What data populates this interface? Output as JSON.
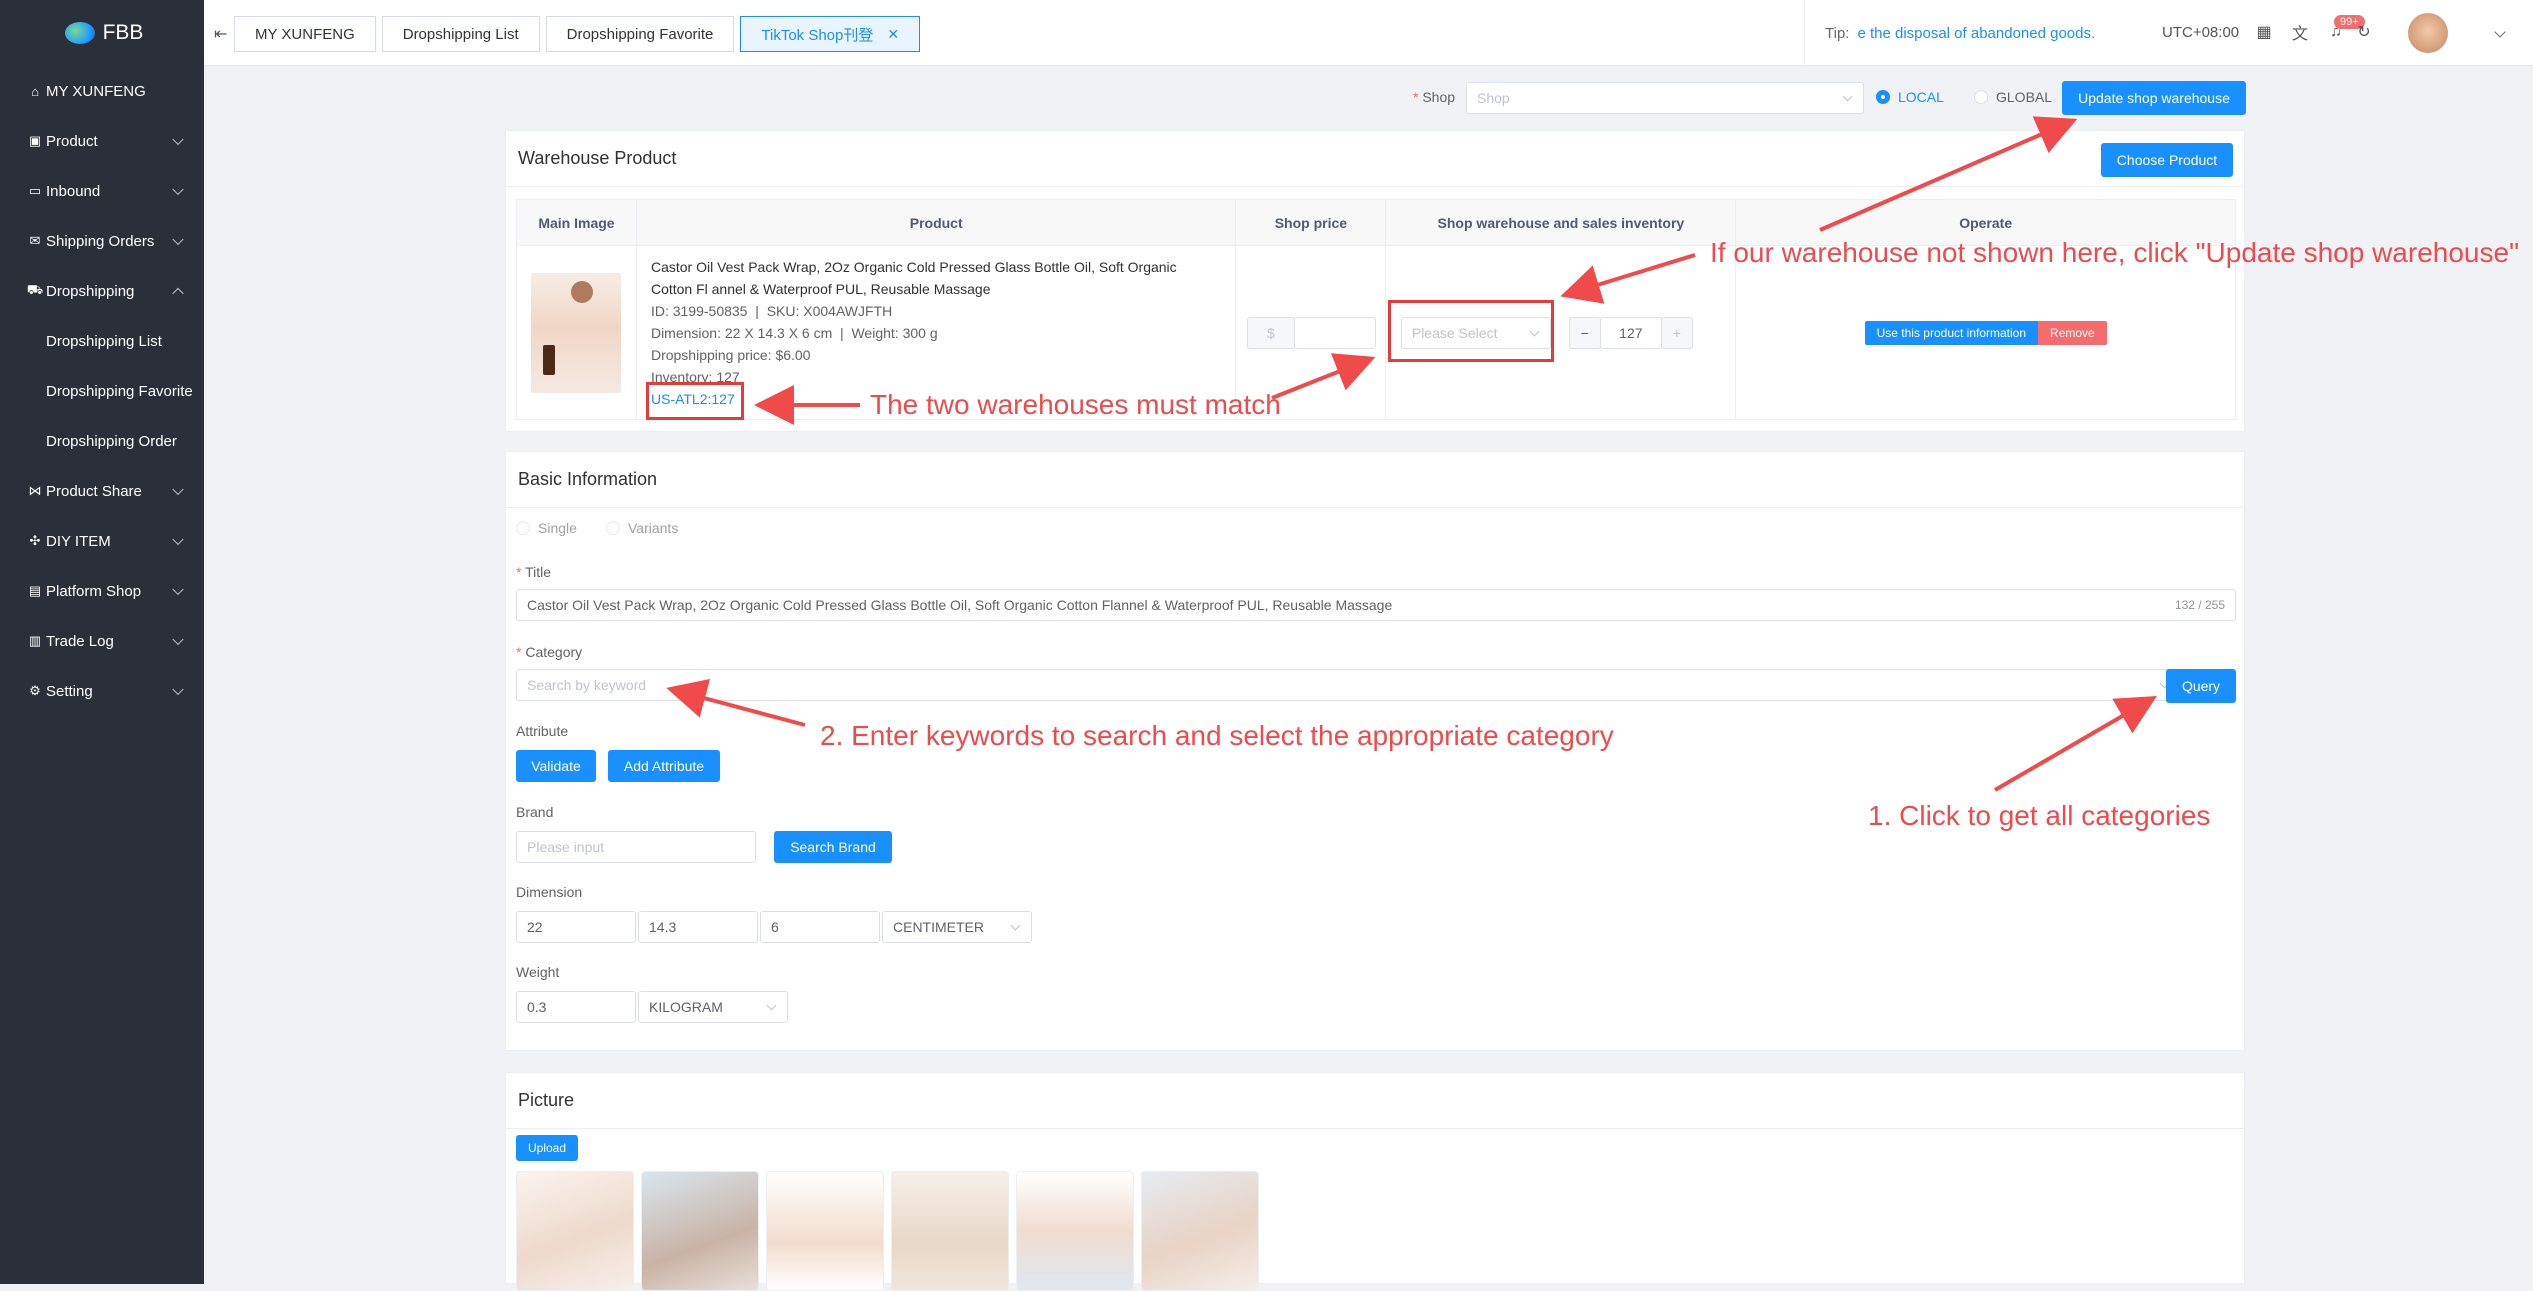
{
  "app": {
    "name": "FBB"
  },
  "sidebar": {
    "items": [
      {
        "label": "MY XUNFENG",
        "icon": "home-icon"
      },
      {
        "label": "Product",
        "icon": "gift-icon"
      },
      {
        "label": "Inbound",
        "icon": "folder-open-icon"
      },
      {
        "label": "Shipping Orders",
        "icon": "mail-icon"
      },
      {
        "label": "Dropshipping",
        "icon": "cart-icon"
      },
      {
        "label": "Product Share",
        "icon": "share-icon"
      },
      {
        "label": "DIY ITEM",
        "icon": "puzzle-icon"
      },
      {
        "label": "Platform Shop",
        "icon": "shop-icon"
      },
      {
        "label": "Trade Log",
        "icon": "document-icon"
      },
      {
        "label": "Setting",
        "icon": "gear-icon"
      }
    ],
    "dropshipping_children": [
      "Dropshipping List",
      "Dropshipping Favorite",
      "Dropshipping Order"
    ]
  },
  "tabs": [
    {
      "label": "MY XUNFENG"
    },
    {
      "label": "Dropshipping List"
    },
    {
      "label": "Dropshipping Favorite"
    },
    {
      "label": "TikTok Shop刊登",
      "active": true
    }
  ],
  "header": {
    "tip_label": "Tip:",
    "tip_text": "e the disposal of abandoned goods.",
    "timezone": "UTC+08:00",
    "notification_badge": "99+"
  },
  "shop_bar": {
    "label": "Shop",
    "placeholder": "Shop",
    "radio_local": "LOCAL",
    "radio_global": "GLOBAL",
    "selected": "LOCAL",
    "update_button": "Update shop warehouse"
  },
  "warehouse_product": {
    "title": "Warehouse Product",
    "choose_button": "Choose Product",
    "columns": [
      "Main Image",
      "Product",
      "Shop price",
      "Shop warehouse and sales inventory",
      "Operate"
    ],
    "row": {
      "title": "Castor Oil Vest Pack Wrap, 2Oz Organic Cold Pressed Glass Bottle Oil, Soft Organic Cotton Fl annel & Waterproof PUL, Reusable Massage",
      "id": "ID: 3199-50835",
      "sku": "SKU: X004AWJFTH",
      "dimension": "Dimension: 22 X 14.3 X 6 cm",
      "weight": "Weight: 300 g",
      "dropshipping_price": "Dropshipping price: $6.00",
      "inventory": "Inventory: 127",
      "warehouse": "US-ATL2:127",
      "currency": "$",
      "select_placeholder": "Please Select",
      "quantity": "127",
      "use_info_button": "Use this product information",
      "remove_button": "Remove"
    }
  },
  "basic_info": {
    "title": "Basic Information",
    "radio_single": "Single",
    "radio_variants": "Variants",
    "title_label": "Title",
    "title_value": "Castor Oil Vest Pack Wrap, 2Oz Organic Cold Pressed Glass Bottle Oil, Soft Organic Cotton Flannel & Waterproof PUL, Reusable Massage",
    "title_count": "132 / 255",
    "category_label": "Category",
    "category_placeholder": "Search by keyword",
    "query_button": "Query",
    "attribute_label": "Attribute",
    "validate_button": "Validate",
    "add_attribute_button": "Add Attribute",
    "brand_label": "Brand",
    "brand_placeholder": "Please input",
    "search_brand_button": "Search Brand",
    "dimension_label": "Dimension",
    "dim_length": "22",
    "dim_width": "14.3",
    "dim_height": "6",
    "dim_unit": "CENTIMETER",
    "weight_label": "Weight",
    "weight_value": "0.3",
    "weight_unit": "KILOGRAM"
  },
  "picture": {
    "title": "Picture",
    "upload_button": "Upload",
    "image_count": 6
  },
  "annotations": {
    "update_warehouse_note": "If our warehouse not shown here,  click \"Update shop warehouse\"",
    "match_note": "The two warehouses must match",
    "category_note": "2. Enter keywords to search and select the appropriate category",
    "query_note": "1. Click to get all categories"
  }
}
